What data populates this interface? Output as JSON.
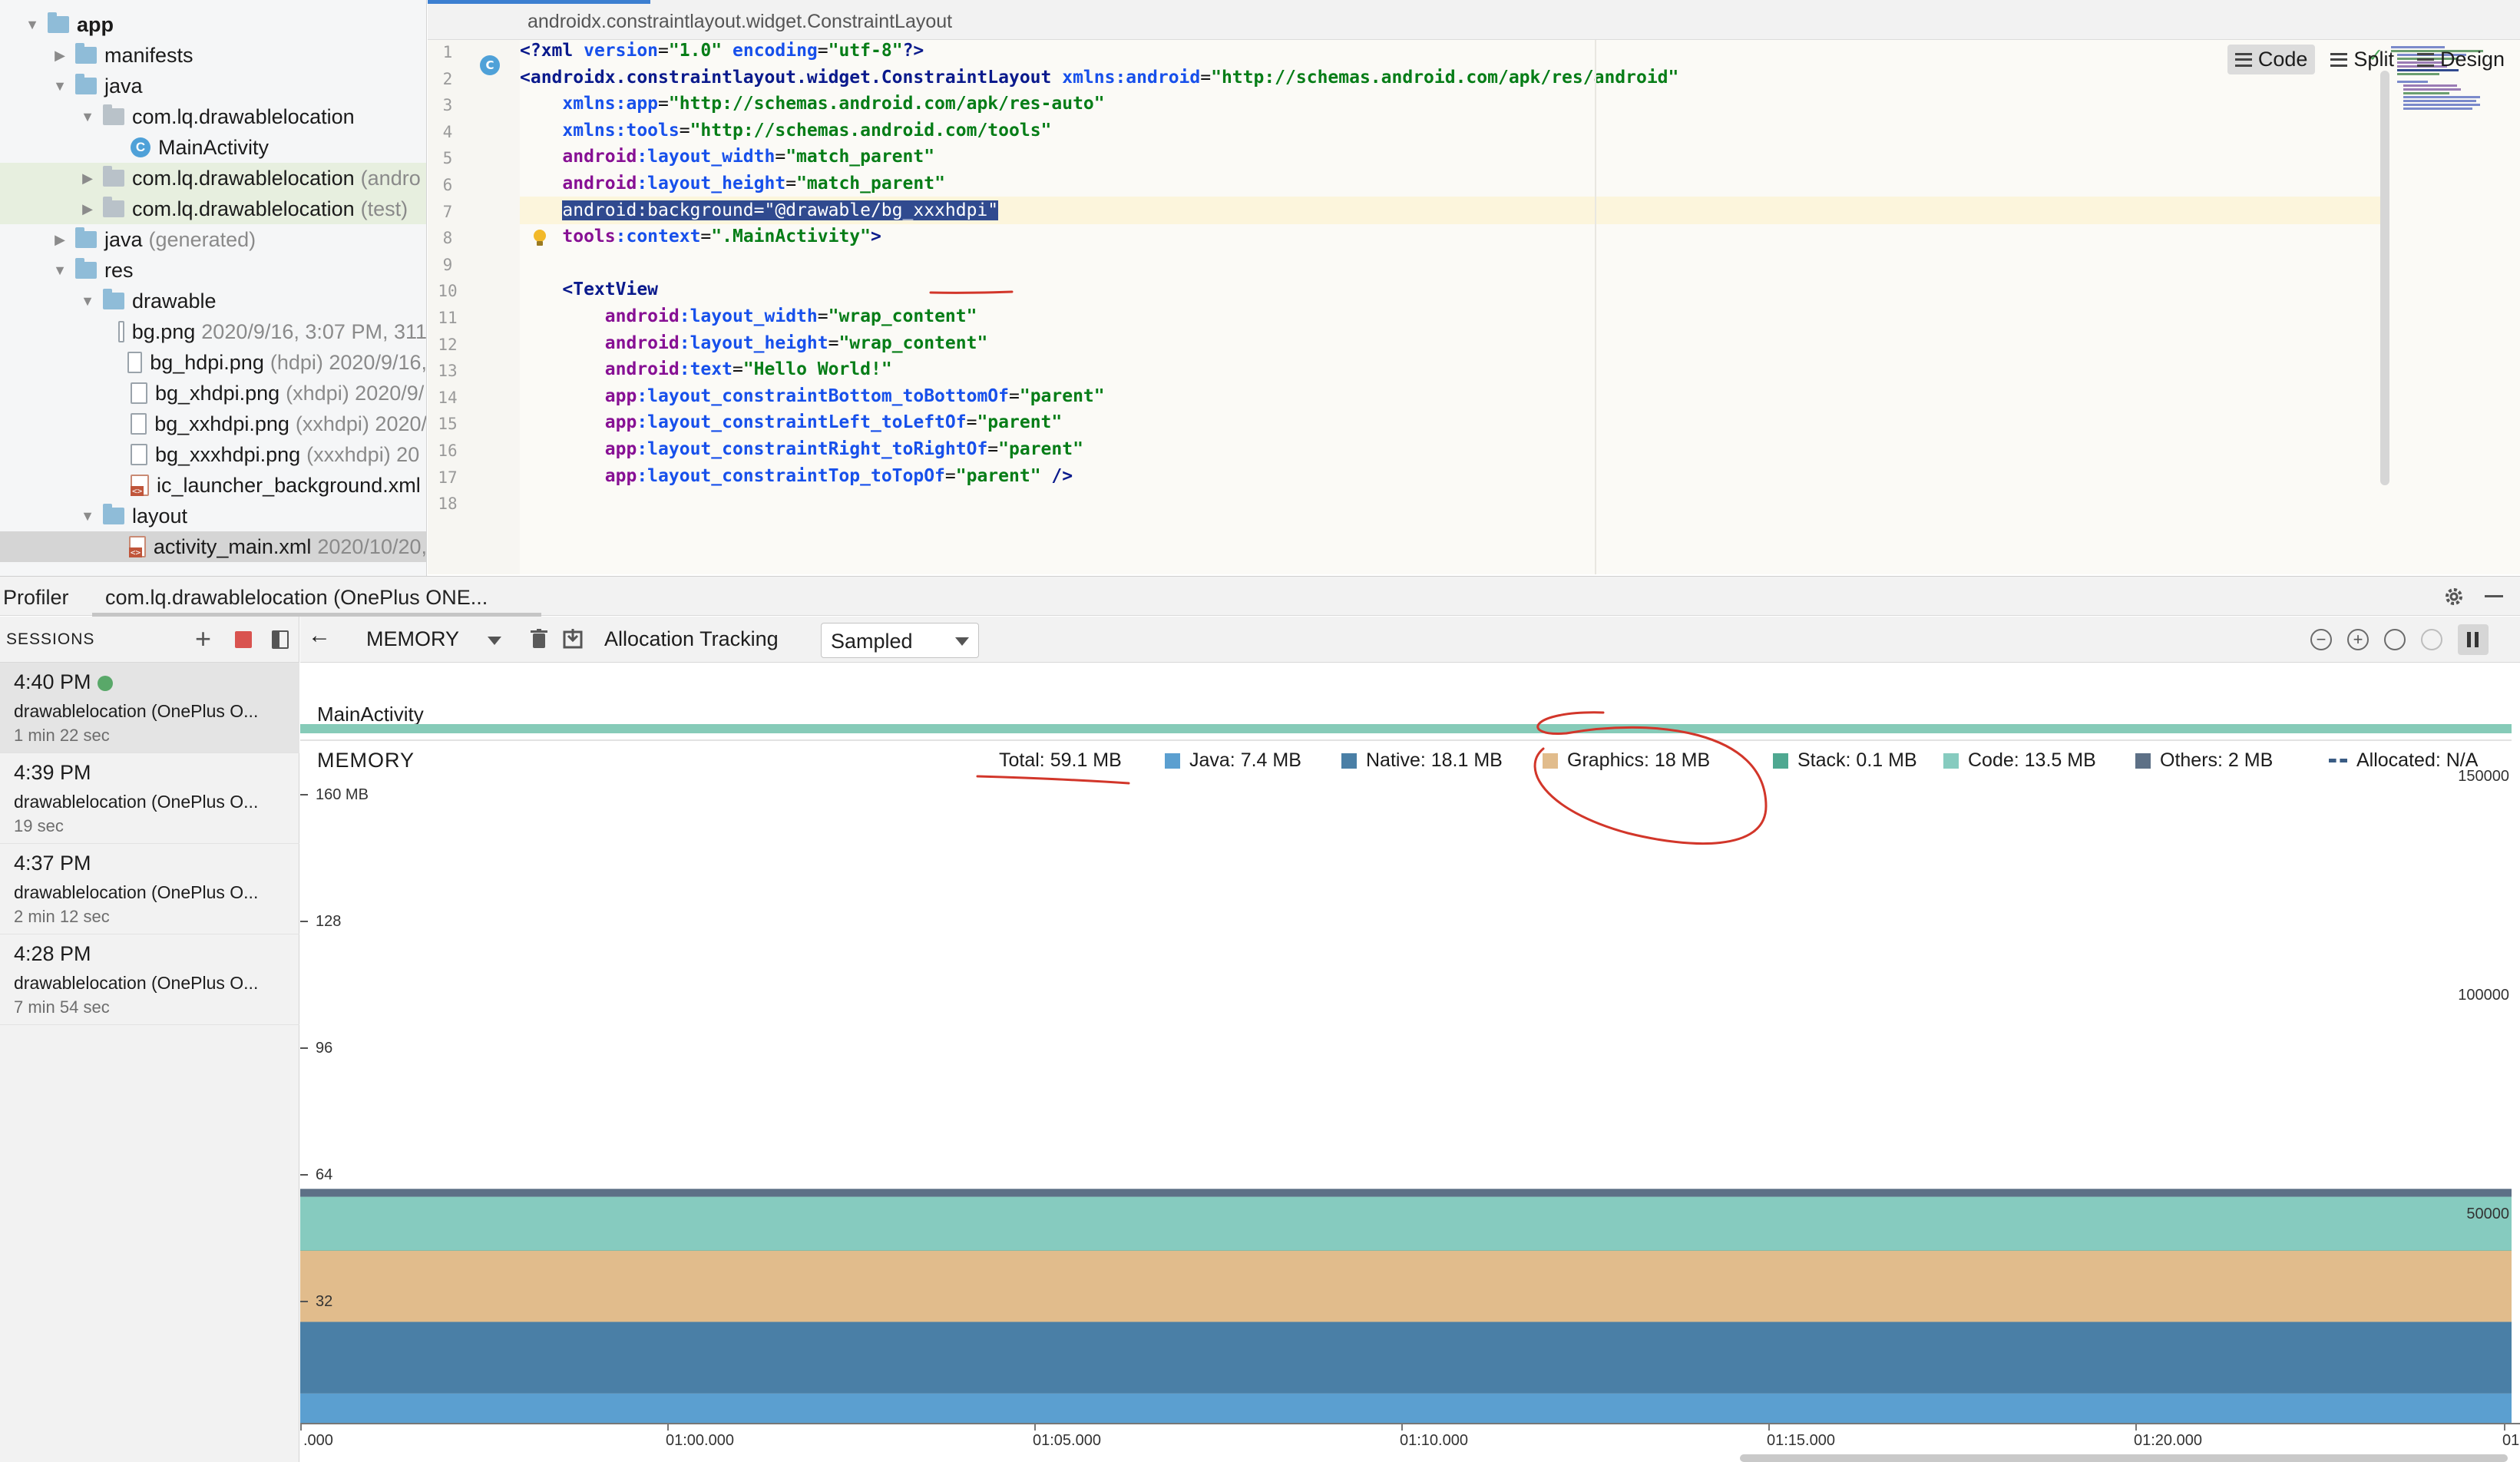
{
  "tree": {
    "items": [
      {
        "label": "app",
        "sub": "",
        "icon": "folder-icon",
        "arrow": "▼",
        "bold": true
      },
      {
        "label": "manifests",
        "sub": "",
        "icon": "folder-icon",
        "arrow": "▶",
        "bold": false
      },
      {
        "label": "java",
        "sub": "",
        "icon": "folder-icon",
        "arrow": "▼",
        "bold": false
      },
      {
        "label": "com.lq.drawablelocation",
        "sub": "",
        "icon": "package-icon",
        "arrow": "▼",
        "bold": false
      },
      {
        "label": "MainActivity",
        "sub": "",
        "icon": "class-icon",
        "arrow": "",
        "bold": false
      },
      {
        "label": "com.lq.drawablelocation",
        "sub": "(andro",
        "icon": "package-icon",
        "arrow": "▶",
        "bold": false
      },
      {
        "label": "com.lq.drawablelocation",
        "sub": "(test)",
        "icon": "package-icon",
        "arrow": "▶",
        "bold": false
      },
      {
        "label": "java",
        "sub": "(generated)",
        "icon": "folder-icon",
        "arrow": "▶",
        "bold": false
      },
      {
        "label": "res",
        "sub": "",
        "icon": "folder-icon",
        "arrow": "▼",
        "bold": false
      },
      {
        "label": "drawable",
        "sub": "",
        "icon": "folder-icon",
        "arrow": "▼",
        "bold": false
      },
      {
        "label": "bg.png",
        "sub": "2020/9/16, 3:07 PM, 311",
        "icon": "image-file-icon",
        "arrow": "",
        "bold": false
      },
      {
        "label": "bg_hdpi.png",
        "sub": "(hdpi)  2020/9/16,",
        "icon": "image-file-icon",
        "arrow": "",
        "bold": false
      },
      {
        "label": "bg_xhdpi.png",
        "sub": "(xhdpi)  2020/9/",
        "icon": "image-file-icon",
        "arrow": "",
        "bold": false
      },
      {
        "label": "bg_xxhdpi.png",
        "sub": "(xxhdpi)  2020/",
        "icon": "image-file-icon",
        "arrow": "",
        "bold": false
      },
      {
        "label": "bg_xxxhdpi.png",
        "sub": "(xxxhdpi)  20",
        "icon": "image-file-icon",
        "arrow": "",
        "bold": false
      },
      {
        "label": "ic_launcher_background.xml",
        "sub": "",
        "icon": "xml-file-icon",
        "arrow": "",
        "bold": false
      },
      {
        "label": "layout",
        "sub": "",
        "icon": "folder-icon",
        "arrow": "▼",
        "bold": false
      },
      {
        "label": "activity_main.xml",
        "sub": "2020/10/20,",
        "icon": "xml-file-icon",
        "arrow": "",
        "bold": false
      }
    ]
  },
  "editor": {
    "breadcrumb": "androidx.constraintlayout.widget.ConstraintLayout",
    "modes": [
      {
        "label": "Code",
        "icon": "code-mode-icon",
        "active": true
      },
      {
        "label": "Split",
        "icon": "split-mode-icon",
        "active": false
      },
      {
        "label": "Design",
        "icon": "design-mode-icon",
        "active": false
      }
    ],
    "line_numbers": [
      "1",
      "2",
      "3",
      "4",
      "5",
      "6",
      "7",
      "8",
      "9",
      "10",
      "11",
      "12",
      "13",
      "14",
      "15",
      "16",
      "17",
      "18"
    ],
    "lines": [
      [
        {
          "t": "<?",
          "c": "tag"
        },
        {
          "t": "xml ",
          "c": "tag"
        },
        {
          "t": "version",
          "c": "attr"
        },
        {
          "t": "=",
          "c": "plain"
        },
        {
          "t": "\"1.0\"",
          "c": "val"
        },
        {
          "t": " ",
          "c": "plain"
        },
        {
          "t": "encoding",
          "c": "attr"
        },
        {
          "t": "=",
          "c": "plain"
        },
        {
          "t": "\"utf-8\"",
          "c": "val"
        },
        {
          "t": "?>",
          "c": "tag"
        }
      ],
      [
        {
          "t": "<androidx.constraintlayout.widget.ConstraintLayout ",
          "c": "tag"
        },
        {
          "t": "xmlns:android",
          "c": "attr"
        },
        {
          "t": "=",
          "c": "plain"
        },
        {
          "t": "\"http://schemas.android.com/apk/res/android\"",
          "c": "val"
        }
      ],
      [
        {
          "t": "    ",
          "c": "plain"
        },
        {
          "t": "xmlns:app",
          "c": "attr"
        },
        {
          "t": "=",
          "c": "plain"
        },
        {
          "t": "\"http://schemas.android.com/apk/res-auto\"",
          "c": "val"
        }
      ],
      [
        {
          "t": "    ",
          "c": "plain"
        },
        {
          "t": "xmlns:tools",
          "c": "attr"
        },
        {
          "t": "=",
          "c": "plain"
        },
        {
          "t": "\"http://schemas.android.com/tools\"",
          "c": "val"
        }
      ],
      [
        {
          "t": "    ",
          "c": "plain"
        },
        {
          "t": "android",
          "c": "ns"
        },
        {
          "t": ":layout_width",
          "c": "attr"
        },
        {
          "t": "=",
          "c": "plain"
        },
        {
          "t": "\"match_parent\"",
          "c": "val"
        }
      ],
      [
        {
          "t": "    ",
          "c": "plain"
        },
        {
          "t": "android",
          "c": "ns"
        },
        {
          "t": ":layout_height",
          "c": "attr"
        },
        {
          "t": "=",
          "c": "plain"
        },
        {
          "t": "\"match_parent\"",
          "c": "val"
        }
      ],
      [
        {
          "t": "    ",
          "c": "plain"
        },
        {
          "t": "android:background=\"@drawable/bg_xxxhdpi\"",
          "c": "sel"
        }
      ],
      [
        {
          "t": "    ",
          "c": "plain"
        },
        {
          "t": "tools",
          "c": "ns"
        },
        {
          "t": ":context",
          "c": "attr"
        },
        {
          "t": "=",
          "c": "plain"
        },
        {
          "t": "\".MainActivity\"",
          "c": "val"
        },
        {
          "t": ">",
          "c": "tag"
        }
      ],
      [],
      [
        {
          "t": "    ",
          "c": "plain"
        },
        {
          "t": "<TextView",
          "c": "tag"
        }
      ],
      [
        {
          "t": "        ",
          "c": "plain"
        },
        {
          "t": "android",
          "c": "ns"
        },
        {
          "t": ":layout_width",
          "c": "attr"
        },
        {
          "t": "=",
          "c": "plain"
        },
        {
          "t": "\"wrap_content\"",
          "c": "val"
        }
      ],
      [
        {
          "t": "        ",
          "c": "plain"
        },
        {
          "t": "android",
          "c": "ns"
        },
        {
          "t": ":layout_height",
          "c": "attr"
        },
        {
          "t": "=",
          "c": "plain"
        },
        {
          "t": "\"wrap_content\"",
          "c": "val"
        }
      ],
      [
        {
          "t": "        ",
          "c": "plain"
        },
        {
          "t": "android",
          "c": "ns"
        },
        {
          "t": ":text",
          "c": "attr"
        },
        {
          "t": "=",
          "c": "plain"
        },
        {
          "t": "\"Hello World!\"",
          "c": "val"
        }
      ],
      [
        {
          "t": "        ",
          "c": "plain"
        },
        {
          "t": "app",
          "c": "ns"
        },
        {
          "t": ":layout_constraintBottom_toBottomOf",
          "c": "attr"
        },
        {
          "t": "=",
          "c": "plain"
        },
        {
          "t": "\"parent\"",
          "c": "val"
        }
      ],
      [
        {
          "t": "        ",
          "c": "plain"
        },
        {
          "t": "app",
          "c": "ns"
        },
        {
          "t": ":layout_constraintLeft_toLeftOf",
          "c": "attr"
        },
        {
          "t": "=",
          "c": "plain"
        },
        {
          "t": "\"parent\"",
          "c": "val"
        }
      ],
      [
        {
          "t": "        ",
          "c": "plain"
        },
        {
          "t": "app",
          "c": "ns"
        },
        {
          "t": ":layout_constraintRight_toRightOf",
          "c": "attr"
        },
        {
          "t": "=",
          "c": "plain"
        },
        {
          "t": "\"parent\"",
          "c": "val"
        }
      ],
      [
        {
          "t": "        ",
          "c": "plain"
        },
        {
          "t": "app",
          "c": "ns"
        },
        {
          "t": ":layout_constraintTop_toTopOf",
          "c": "attr"
        },
        {
          "t": "=",
          "c": "plain"
        },
        {
          "t": "\"parent\"",
          "c": "val"
        },
        {
          "t": " />",
          "c": "tag"
        }
      ],
      []
    ]
  },
  "profiler": {
    "title": "Profiler",
    "tab": "com.lq.drawablelocation (OnePlus ONE...",
    "sessions_label": "SESSIONS",
    "sessions": [
      {
        "time": "4:40 PM",
        "name": "drawablelocation (OnePlus O...",
        "duration": "1 min 22 sec",
        "live": true
      },
      {
        "time": "4:39 PM",
        "name": "drawablelocation (OnePlus O...",
        "duration": "19 sec",
        "live": false
      },
      {
        "time": "4:37 PM",
        "name": "drawablelocation (OnePlus O...",
        "duration": "2 min 12 sec",
        "live": false
      },
      {
        "time": "4:28 PM",
        "name": "drawablelocation (OnePlus O...",
        "duration": "7 min 54 sec",
        "live": false
      }
    ],
    "toolbar": {
      "profiler_select": "MEMORY",
      "allocation_label": "Allocation Tracking",
      "sampling_value": "Sampled"
    },
    "activity_label": "MainActivity",
    "memory_title": "MEMORY",
    "legend": [
      {
        "label": "Total: 59.1 MB",
        "color": ""
      },
      {
        "label": "Java: 7.4 MB",
        "color": "#5b9fd0"
      },
      {
        "label": "Native: 18.1 MB",
        "color": "#4a7fa6"
      },
      {
        "label": "Graphics: 18 MB",
        "color": "#e1bc8c"
      },
      {
        "label": "Stack: 0.1 MB",
        "color": "#4fa891"
      },
      {
        "label": "Code: 13.5 MB",
        "color": "#86cbbf"
      },
      {
        "label": "Others: 2 MB",
        "color": "#5d7086"
      },
      {
        "label": "Allocated: N/A",
        "color": "#3a5c84"
      }
    ],
    "y_left": [
      "160 MB",
      "128",
      "96",
      "64",
      "32"
    ],
    "y_right": [
      "150000",
      "100000",
      "50000"
    ],
    "x_ticks": [
      ".000",
      "01:00.000",
      "01:05.000",
      "01:10.000",
      "01:15.000",
      "01:20.000",
      "01:"
    ]
  },
  "chart_data": {
    "type": "area",
    "title": "MEMORY",
    "xlabel": "",
    "ylabel": "",
    "ylim": [
      0,
      160
    ],
    "y2lim": [
      0,
      150000
    ],
    "x_ticks": [
      ".000",
      "01:00.000",
      "01:05.000",
      "01:10.000",
      "01:15.000",
      "01:20.000",
      "01:"
    ],
    "series": [
      {
        "name": "Java",
        "color": "#5b9fd0",
        "values": [
          7.4
        ]
      },
      {
        "name": "Native",
        "color": "#4a7fa6",
        "values": [
          18.1
        ]
      },
      {
        "name": "Graphics",
        "color": "#e1bc8c",
        "values": [
          18
        ]
      },
      {
        "name": "Stack",
        "color": "#4fa891",
        "values": [
          0.1
        ]
      },
      {
        "name": "Code",
        "color": "#86cbbf",
        "values": [
          13.5
        ]
      },
      {
        "name": "Others",
        "color": "#5d7086",
        "values": [
          2
        ]
      }
    ],
    "total": 59.1,
    "stacked": true,
    "legend": "top"
  },
  "annotation_colors": {
    "stroke": "#d2362a"
  }
}
